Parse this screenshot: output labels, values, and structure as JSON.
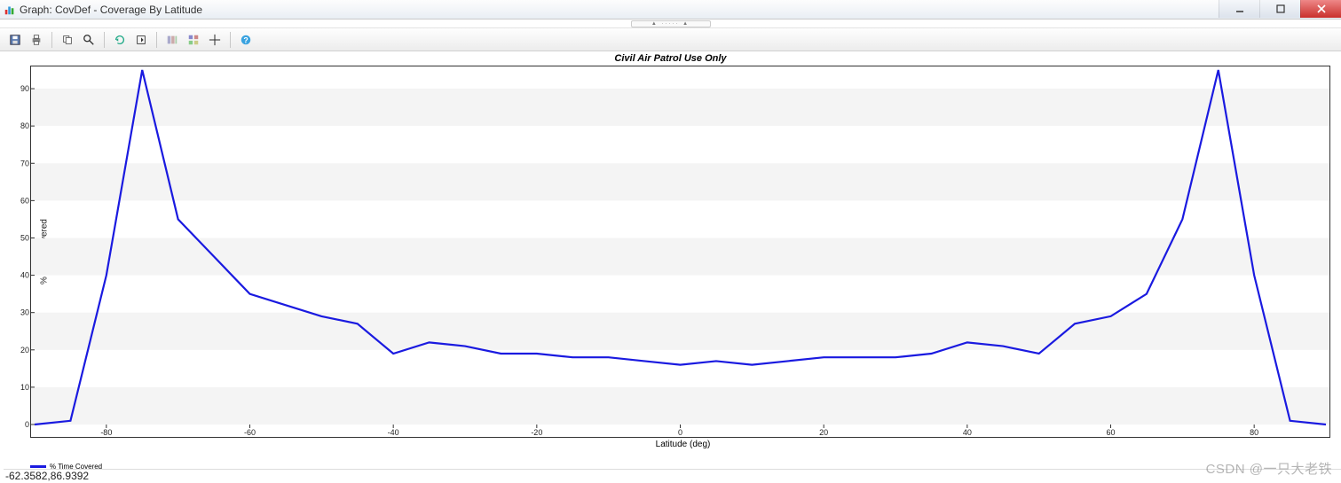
{
  "window": {
    "title": "Graph:  CovDef - Coverage By Latitude"
  },
  "toolbar": {
    "save": "Save",
    "print": "Print",
    "copy": "Copy",
    "zoom": "Zoom",
    "refresh": "Refresh",
    "export": "Export",
    "tool1": "Options",
    "tool2": "Grid",
    "crosshair": "Crosshair",
    "help": "Help"
  },
  "chart": {
    "title": "Civil Air Patrol Use Only",
    "xlabel": "Latitude (deg)",
    "ylabel": "% Time Covered",
    "legend": "% Time Covered"
  },
  "status": {
    "coords": "-62.3582,86.9392"
  },
  "watermark": "CSDN @一只大老铁",
  "chart_data": {
    "type": "line",
    "title": "Civil Air Patrol Use Only",
    "xlabel": "Latitude (deg)",
    "ylabel": "% Time Covered",
    "xlim": [
      -90,
      90
    ],
    "ylim": [
      0,
      95
    ],
    "x_ticks": [
      -80,
      -60,
      -40,
      -20,
      0,
      20,
      40,
      60,
      80
    ],
    "y_ticks": [
      0,
      10,
      20,
      30,
      40,
      50,
      60,
      70,
      80,
      90
    ],
    "series": [
      {
        "name": "% Time Covered",
        "color": "#1a1ae0",
        "x": [
          -90,
          -85,
          -80,
          -75,
          -70,
          -65,
          -60,
          -55,
          -50,
          -45,
          -40,
          -35,
          -30,
          -25,
          -20,
          -15,
          -10,
          -5,
          0,
          5,
          10,
          15,
          20,
          25,
          30,
          35,
          40,
          45,
          50,
          55,
          60,
          65,
          70,
          75,
          80,
          85,
          90
        ],
        "y": [
          0,
          1,
          40,
          95,
          55,
          45,
          35,
          32,
          29,
          27,
          19,
          22,
          21,
          19,
          19,
          18,
          18,
          17,
          16,
          17,
          16,
          17,
          18,
          18,
          18,
          19,
          22,
          21,
          19,
          27,
          29,
          35,
          55,
          95,
          40,
          1,
          0
        ]
      }
    ]
  }
}
